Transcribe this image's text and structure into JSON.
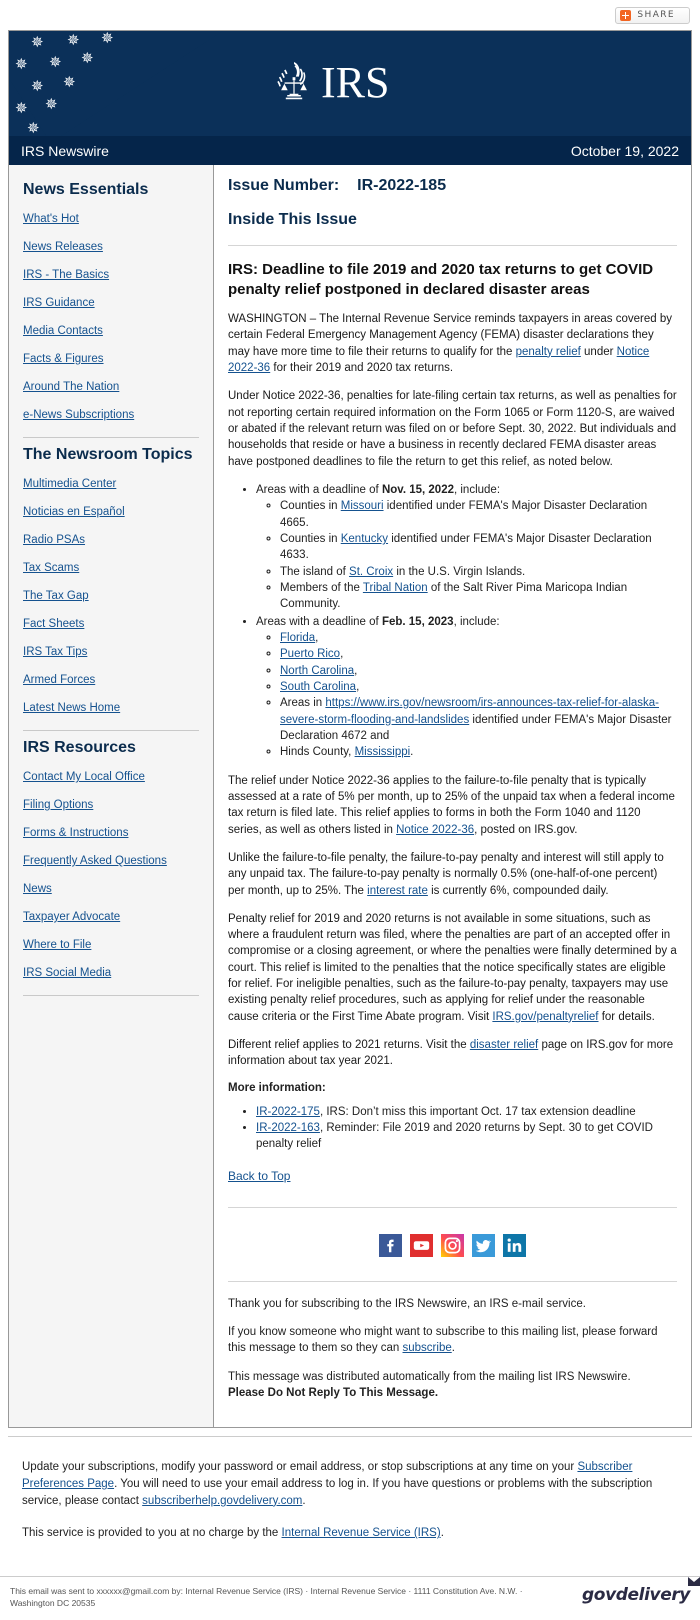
{
  "share": {
    "label": "SHARE",
    "icon": "share-plus-icon"
  },
  "masthead": {
    "logo_text": "IRS",
    "logo_mark": "irs-eagle-scales-icon",
    "flag_icon": "us-flag-icon"
  },
  "newswire": {
    "title": "IRS Newswire",
    "date": "October 19, 2022"
  },
  "sidebar": {
    "sections": [
      {
        "heading": "News Essentials",
        "items": [
          "What's Hot",
          "News Releases",
          "IRS - The Basics",
          "IRS Guidance",
          "Media Contacts",
          "Facts & Figures",
          "Around The Nation",
          "e-News Subscriptions"
        ]
      },
      {
        "heading": "The Newsroom Topics",
        "items": [
          "Multimedia Center",
          "Noticias en Español",
          "Radio PSAs",
          "Tax Scams",
          "The Tax Gap",
          "Fact Sheets",
          "IRS Tax Tips",
          "Armed Forces",
          "Latest News Home"
        ]
      },
      {
        "heading": "IRS Resources",
        "items": [
          "Contact My Local Office",
          "Filing Options",
          "Forms & Instructions",
          "Frequently Asked Questions",
          "News",
          "Taxpayer Advocate",
          "Where to File",
          "IRS Social Media"
        ]
      }
    ]
  },
  "main": {
    "issue_label": "Issue Number:",
    "issue_number": "IR-2022-185",
    "inside_this_issue": "Inside This Issue",
    "headline": "IRS: Deadline to file 2019 and 2020 tax returns to get COVID penalty relief postponed in declared disaster areas",
    "para1": {
      "t1": "WASHINGTON – The Internal Revenue Service reminds taxpayers in areas covered by certain Federal Emergency Management Agency (FEMA) disaster declarations they may have more time to file their returns to qualify for the ",
      "link1": "penalty relief",
      "t2": " under ",
      "link2": "Notice 2022-36",
      "t3": " for their 2019 and 2020 tax returns."
    },
    "para2": "Under Notice 2022-36, penalties for late-filing certain tax returns, as well as penalties for not reporting certain required information on the Form 1065 or Form 1120-S, are waived or abated if the relevant return was filed on or before Sept. 30, 2022. But individuals and households that reside or have a business in recently declared FEMA disaster areas have postponed deadlines to file the return to get this relief, as noted below.",
    "deadline_groups": [
      {
        "lead_pre": "Areas with a deadline of ",
        "lead_date": "Nov. 15, 2022",
        "lead_post": ", include:",
        "items": [
          {
            "pre": "Counties in ",
            "link": "Missouri",
            "post": " identified under FEMA's Major Disaster Declaration 4665."
          },
          {
            "pre": "Counties in ",
            "link": "Kentucky",
            "post": " identified under FEMA's Major Disaster Declaration 4633."
          },
          {
            "pre": "The island of ",
            "link": "St. Croix",
            "post": " in the U.S. Virgin Islands."
          },
          {
            "pre": "Members of the ",
            "link": "Tribal Nation",
            "post": " of the Salt River Pima Maricopa Indian Community."
          }
        ]
      },
      {
        "lead_pre": "Areas with a deadline of ",
        "lead_date": "Feb. 15, 2023",
        "lead_post": ", include:",
        "items": [
          {
            "pre": "",
            "link": "Florida",
            "post": ","
          },
          {
            "pre": "",
            "link": "Puerto Rico",
            "post": ","
          },
          {
            "pre": "",
            "link": "North Carolina",
            "post": ","
          },
          {
            "pre": "",
            "link": "South Carolina",
            "post": ","
          },
          {
            "pre": "Areas in ",
            "link": "https://www.irs.gov/newsroom/irs-announces-tax-relief-for-alaska-severe-storm-flooding-and-landslides",
            "post": " identified under FEMA's Major Disaster Declaration 4672 and"
          },
          {
            "pre": "Hinds County, ",
            "link": "Mississippi",
            "post": "."
          }
        ]
      }
    ],
    "para3": {
      "t1": "The relief under Notice 2022-36 applies to the failure-to-file penalty that is typically assessed at a rate of 5% per month, up to 25% of the unpaid tax when a federal income tax return is filed late. This relief applies to forms in both the Form 1040 and 1120 series, as well as others listed in ",
      "link1": "Notice 2022-36",
      "t2": ", posted on IRS.gov."
    },
    "para4": {
      "t1": "Unlike the failure-to-file penalty, the failure-to-pay penalty and interest will still apply to any unpaid tax. The failure-to-pay penalty is normally 0.5% (one-half-of-one percent) per month, up to 25%. The ",
      "link1": "interest rate",
      "t2": " is currently 6%, compounded daily."
    },
    "para5": {
      "t1": "Penalty relief for 2019 and 2020 returns is not available in some situations, such as where a fraudulent return was filed, where the penalties are part of an accepted offer in compromise or a closing agreement, or where the penalties were finally determined by a court. This relief is limited to the penalties that the notice specifically states are eligible for relief. For ineligible penalties, such as the failure-to-pay penalty, taxpayers may use existing penalty relief procedures, such as applying for relief under the reasonable cause criteria or the First Time Abate program. Visit ",
      "link1": "IRS.gov/penaltyrelief",
      "t2": " for details."
    },
    "para6": {
      "t1": "Different relief applies to 2021 returns. Visit the ",
      "link1": "disaster relief",
      "t2": " page on IRS.gov for more information about tax year 2021."
    },
    "more_info_label": "More information:",
    "references": [
      {
        "link": "IR-2022-175",
        "text": ", IRS: Don’t miss this important Oct. 17 tax extension deadline"
      },
      {
        "link": "IR-2022-163",
        "text": ", Reminder: File 2019 and 2020 returns by Sept. 30 to get COVID penalty relief"
      }
    ],
    "back_to_top": "Back to Top",
    "social_icons": [
      "facebook-icon",
      "youtube-icon",
      "instagram-icon",
      "twitter-icon",
      "linkedin-icon"
    ],
    "thanks1": "Thank you for subscribing to the IRS Newswire, an IRS e-mail service.",
    "thanks2": {
      "t1": "If you know someone who might want to subscribe to this mailing list, please forward this message to them so they can ",
      "link1": "subscribe",
      "t2": "."
    },
    "thanks3_plain": "This message was distributed automatically from the mailing list IRS Newswire.",
    "thanks3_bold": "Please Do Not Reply To This Message."
  },
  "subscription": {
    "p1": {
      "t1": "Update your subscriptions, modify your password or email address, or stop subscriptions at any time on your ",
      "link1": "Subscriber Preferences Page",
      "t2": ". You will need to use your email address to log in. If you have questions or problems with the subscription service, please contact ",
      "link2": "subscriberhelp.govdelivery.com",
      "t3": "."
    },
    "p2": {
      "t1": "This service is provided to you at no charge by the ",
      "link1": "Internal Revenue Service (IRS)",
      "t2": "."
    }
  },
  "footer": {
    "sent_text": "This email was sent to xxxxxx@gmail.com by: Internal Revenue Service (IRS) · Internal Revenue Service · 1111 Constitution Ave. N.W. · Washington DC 20535",
    "brand": "govdelivery"
  },
  "colors": {
    "navy_banner": "#0b3059",
    "navy_strip": "#05254a",
    "link": "#15528f",
    "heading": "#0b2c4d",
    "flag_red": "#b32134",
    "share_orange": "#f26522"
  }
}
